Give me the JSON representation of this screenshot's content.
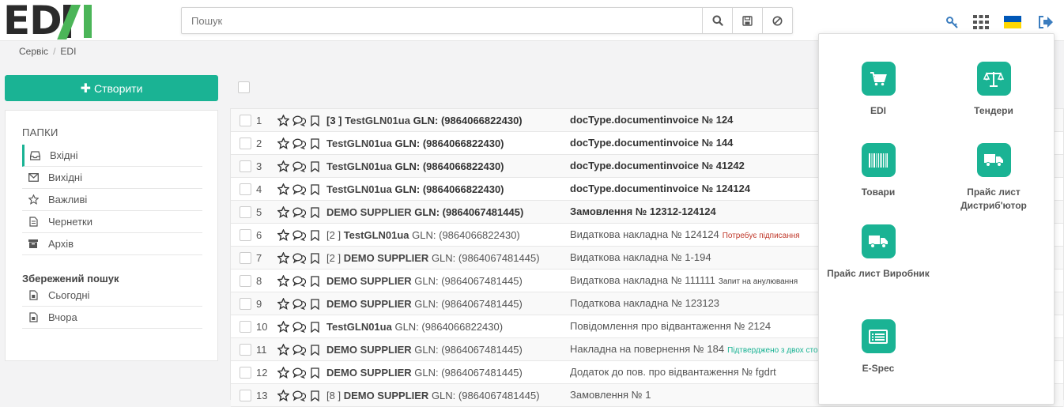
{
  "logo": {
    "text_left": "ED",
    "text_n": "N"
  },
  "search": {
    "placeholder": "Пошук"
  },
  "breadcrumb": {
    "items": [
      "Сервіс",
      "EDI"
    ]
  },
  "sidebar": {
    "create_label": "Створити",
    "folders_title": "ПАПКИ",
    "folders": [
      {
        "label": "Вхідні",
        "icon": "inbox-icon"
      },
      {
        "label": "Вихідні",
        "icon": "envelope-icon"
      },
      {
        "label": "Важливі",
        "icon": "star-icon"
      },
      {
        "label": "Чернетки",
        "icon": "draft-icon"
      },
      {
        "label": "Архів",
        "icon": "archive-icon"
      }
    ],
    "saved_title": "Збережений пошук",
    "saved": [
      {
        "label": "Сьогодні",
        "icon": "calendar-icon"
      },
      {
        "label": "Вчора",
        "icon": "calendar-icon"
      }
    ]
  },
  "rows": [
    {
      "num": "1",
      "prefix": "[3 ] ",
      "name": "TestGLN01ua",
      "gln": "GLN: (9864066822430)",
      "doc": "docType.documentinvoice № 124",
      "tag": "",
      "bold": true
    },
    {
      "num": "2",
      "prefix": "",
      "name": "TestGLN01ua",
      "gln": "GLN: (9864066822430)",
      "doc": "docType.documentinvoice № 144",
      "tag": "",
      "bold": true
    },
    {
      "num": "3",
      "prefix": "",
      "name": "TestGLN01ua",
      "gln": "GLN: (9864066822430)",
      "doc": "docType.documentinvoice № 41242",
      "tag": "",
      "bold": true
    },
    {
      "num": "4",
      "prefix": "",
      "name": "TestGLN01ua",
      "gln": "GLN: (9864066822430)",
      "doc": "docType.documentinvoice № 124124",
      "tag": "",
      "bold": true
    },
    {
      "num": "5",
      "prefix": "",
      "name": "DEMO SUPPLIER",
      "gln": "GLN: (9864067481445)",
      "doc": "Замовлення № 12312-124124",
      "tag": "",
      "bold": true
    },
    {
      "num": "6",
      "prefix": "[2 ] ",
      "name": "TestGLN01ua",
      "gln": "GLN: (9864066822430)",
      "doc": "Видаткова накладна № 124124",
      "tag": "Потребує підписання",
      "tagcolor": "red",
      "bold": false
    },
    {
      "num": "7",
      "prefix": "[2 ] ",
      "name": "DEMO SUPPLIER",
      "gln": "GLN: (9864067481445)",
      "doc": "Видаткова накладна № 1-194",
      "tag": "",
      "bold": false
    },
    {
      "num": "8",
      "prefix": "",
      "name": "DEMO SUPPLIER",
      "gln": "GLN: (9864067481445)",
      "doc": "Видаткова накладна № 111111",
      "tag": "Запит на анулювання",
      "tagcolor": "dark",
      "bold": false
    },
    {
      "num": "9",
      "prefix": "",
      "name": "DEMO SUPPLIER",
      "gln": "GLN: (9864067481445)",
      "doc": "Податкова накладна № 123123",
      "tag": "",
      "bold": false
    },
    {
      "num": "10",
      "prefix": "",
      "name": "TestGLN01ua",
      "gln": "GLN: (9864066822430)",
      "doc": "Повідомлення про відвантаження № 2124",
      "tag": "",
      "bold": false
    },
    {
      "num": "11",
      "prefix": "",
      "name": "DEMO SUPPLIER",
      "gln": "GLN: (9864067481445)",
      "doc": "Накладна на повернення № 184",
      "tag": "Підтверджено з двох сто",
      "tagcolor": "green",
      "bold": false
    },
    {
      "num": "12",
      "prefix": "",
      "name": "DEMO SUPPLIER",
      "gln": "GLN: (9864067481445)",
      "doc": "Додаток до пов. про відвантаження № fgdrt",
      "tag": "",
      "bold": false
    },
    {
      "num": "13",
      "prefix": "[8 ] ",
      "name": "DEMO SUPPLIER",
      "gln": "GLN: (9864067481445)",
      "doc": "Замовлення № 1",
      "tag": "",
      "bold": false
    }
  ],
  "apps": [
    {
      "label": "EDI",
      "icon": "cart-icon"
    },
    {
      "label": "Тендери",
      "icon": "scales-icon"
    },
    {
      "label": "Товари",
      "icon": "barcode-icon"
    },
    {
      "label": "Прайс лист Дистриб'ютор",
      "icon": "truck-icon"
    },
    {
      "label": "Прайс лист Виробник",
      "icon": "truck-icon"
    },
    {
      "label": "E-Spec",
      "icon": "list-icon"
    }
  ],
  "colors": {
    "accent": "#1ab394",
    "logo_green": "#4bb558",
    "topicon_blue": "#3b7dbf",
    "flag_blue": "#0057b7",
    "flag_yellow": "#ffd700"
  }
}
